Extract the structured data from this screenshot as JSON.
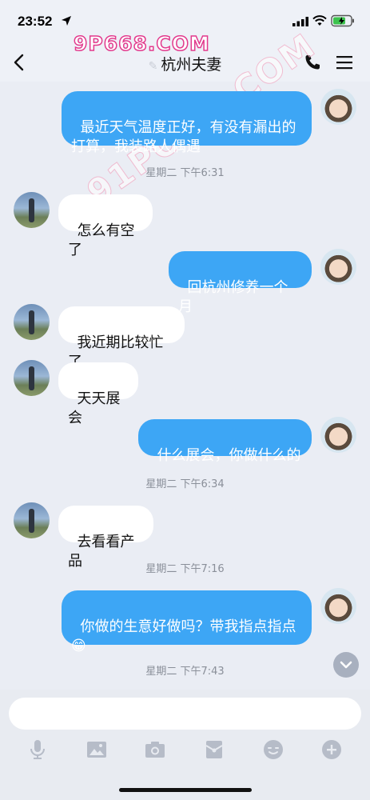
{
  "status_bar": {
    "time": "23:52"
  },
  "nav": {
    "title": "杭州夫妻",
    "pin_glyph": "✎"
  },
  "watermarks": {
    "top": "9P668.COM",
    "diagonal": "91PORN.COM"
  },
  "messages": [
    {
      "side": "out",
      "text": "最近天气温度正好，有没有漏出的\n打算，我装路人偶遇"
    },
    {
      "type": "time",
      "text": "星期二 下午6:31"
    },
    {
      "side": "in",
      "text": "怎么有空了"
    },
    {
      "side": "out",
      "text": "回杭州修养一个月"
    },
    {
      "side": "in",
      "text": "我近期比较忙了"
    },
    {
      "side": "in",
      "text": "天天展会"
    },
    {
      "side": "out",
      "text": "什么展会，你做什么的"
    },
    {
      "type": "time",
      "text": "星期二 下午6:34"
    },
    {
      "side": "in",
      "text": "去看看产品"
    },
    {
      "type": "time",
      "text": "星期二 下午7:16"
    },
    {
      "side": "out",
      "text": "你做的生意好做吗？带我指点指点\n😁"
    },
    {
      "type": "time",
      "text": "星期二 下午7:43"
    }
  ],
  "input": {
    "placeholder": ""
  },
  "toolbar": [
    "microphone-icon",
    "image-icon",
    "camera-icon",
    "red-packet-icon",
    "emoji-icon",
    "plus-icon"
  ],
  "colors": {
    "bubble_out": "#3da6f5",
    "bubble_in": "#ffffff",
    "background": "#eaedf4"
  }
}
